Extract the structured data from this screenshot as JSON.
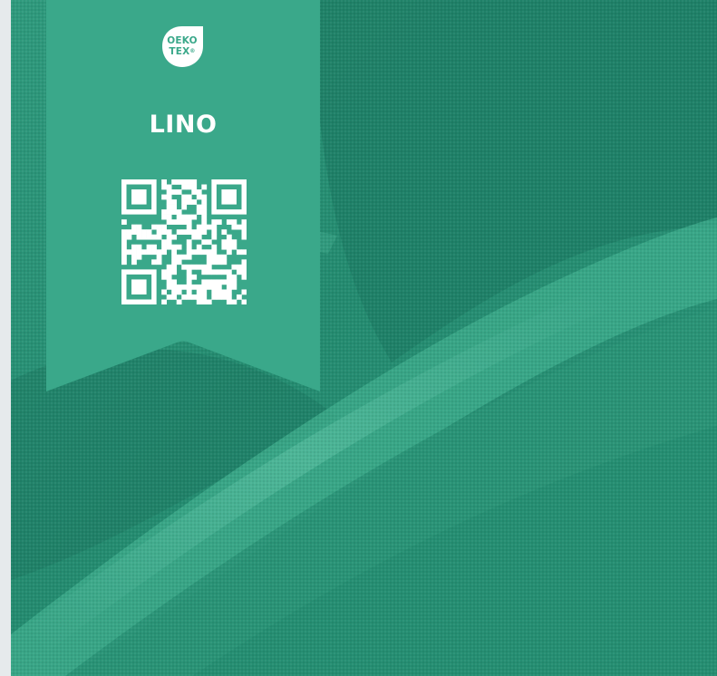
{
  "badge": {
    "line1": "OEKO",
    "line2": "TEX",
    "mark": "®",
    "icon": "oeko-tex-leaf-icon"
  },
  "label": {
    "title": "LINO"
  },
  "qr": {
    "icon": "qr-code-icon"
  },
  "colors": {
    "ribbon": "#3aa88a",
    "fabric": "#238a70",
    "text": "#ffffff"
  }
}
